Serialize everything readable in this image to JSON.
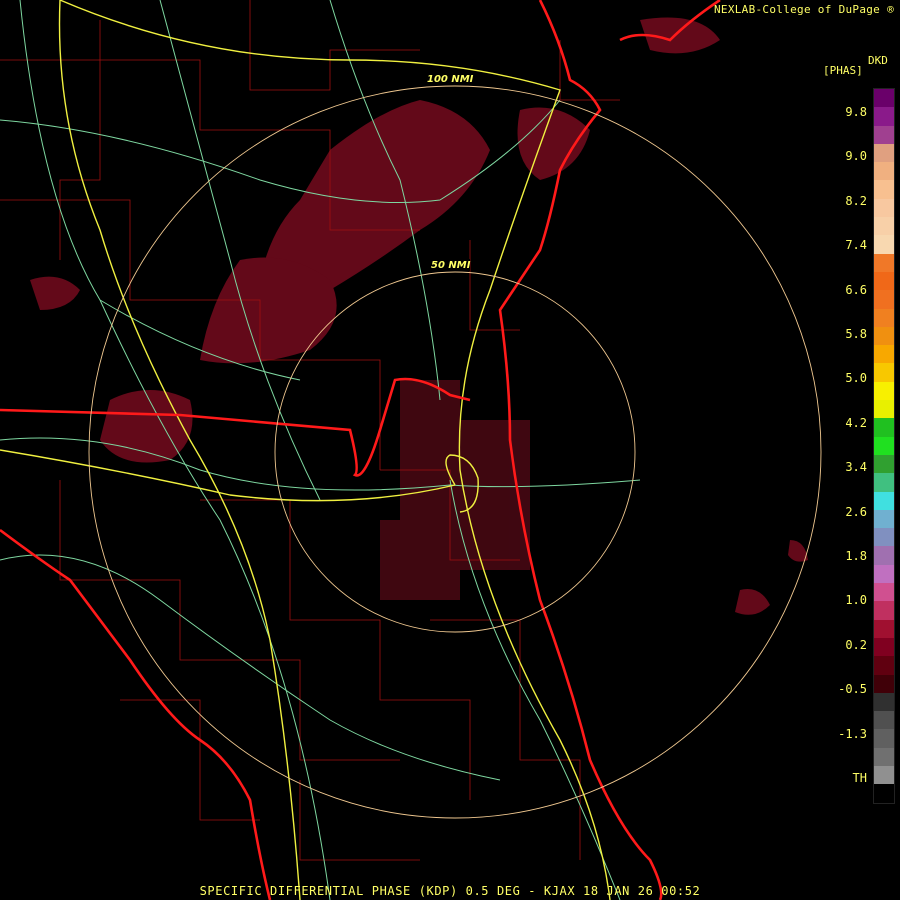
{
  "header": {
    "credit": "NEXLAB-College of DuPage"
  },
  "product": {
    "unit_code": "DKD",
    "unit_name": "[PHAS]",
    "footer": "SPECIFIC DIFFERENTIAL PHASE (KDP) 0.5 DEG - KJAX 18 JAN 26 00:52"
  },
  "range_rings": {
    "inner_label": "50 NMI",
    "outer_label": "100 NMI"
  },
  "legend": {
    "ticks": [
      "9.8",
      "9.0",
      "8.2",
      "7.4",
      "6.6",
      "5.8",
      "5.0",
      "4.2",
      "3.4",
      "2.6",
      "1.8",
      "1.0",
      "0.2",
      "-0.5",
      "-1.3",
      "TH"
    ],
    "colors": [
      "#6a006a",
      "#8a1a8a",
      "#a04090",
      "#e0a080",
      "#f0b080",
      "#f8c090",
      "#f8c8a0",
      "#f8d0a8",
      "#f8d8b0",
      "#f07828",
      "#f06818",
      "#f07020",
      "#f08020",
      "#f09010",
      "#f8a800",
      "#f8c800",
      "#f8f000",
      "#e8f000",
      "#20c020",
      "#20e020",
      "#30a030",
      "#40c080",
      "#40e0e0",
      "#70b0d0",
      "#8090c0",
      "#a070b0",
      "#c070c0",
      "#d05090",
      "#c03060",
      "#a01030",
      "#800020",
      "#600010",
      "#400008",
      "#303030",
      "#505050",
      "#606060",
      "#707070",
      "#909090",
      "#000000"
    ]
  },
  "icons": {
    "credit_icon": "reserved-r-icon"
  }
}
